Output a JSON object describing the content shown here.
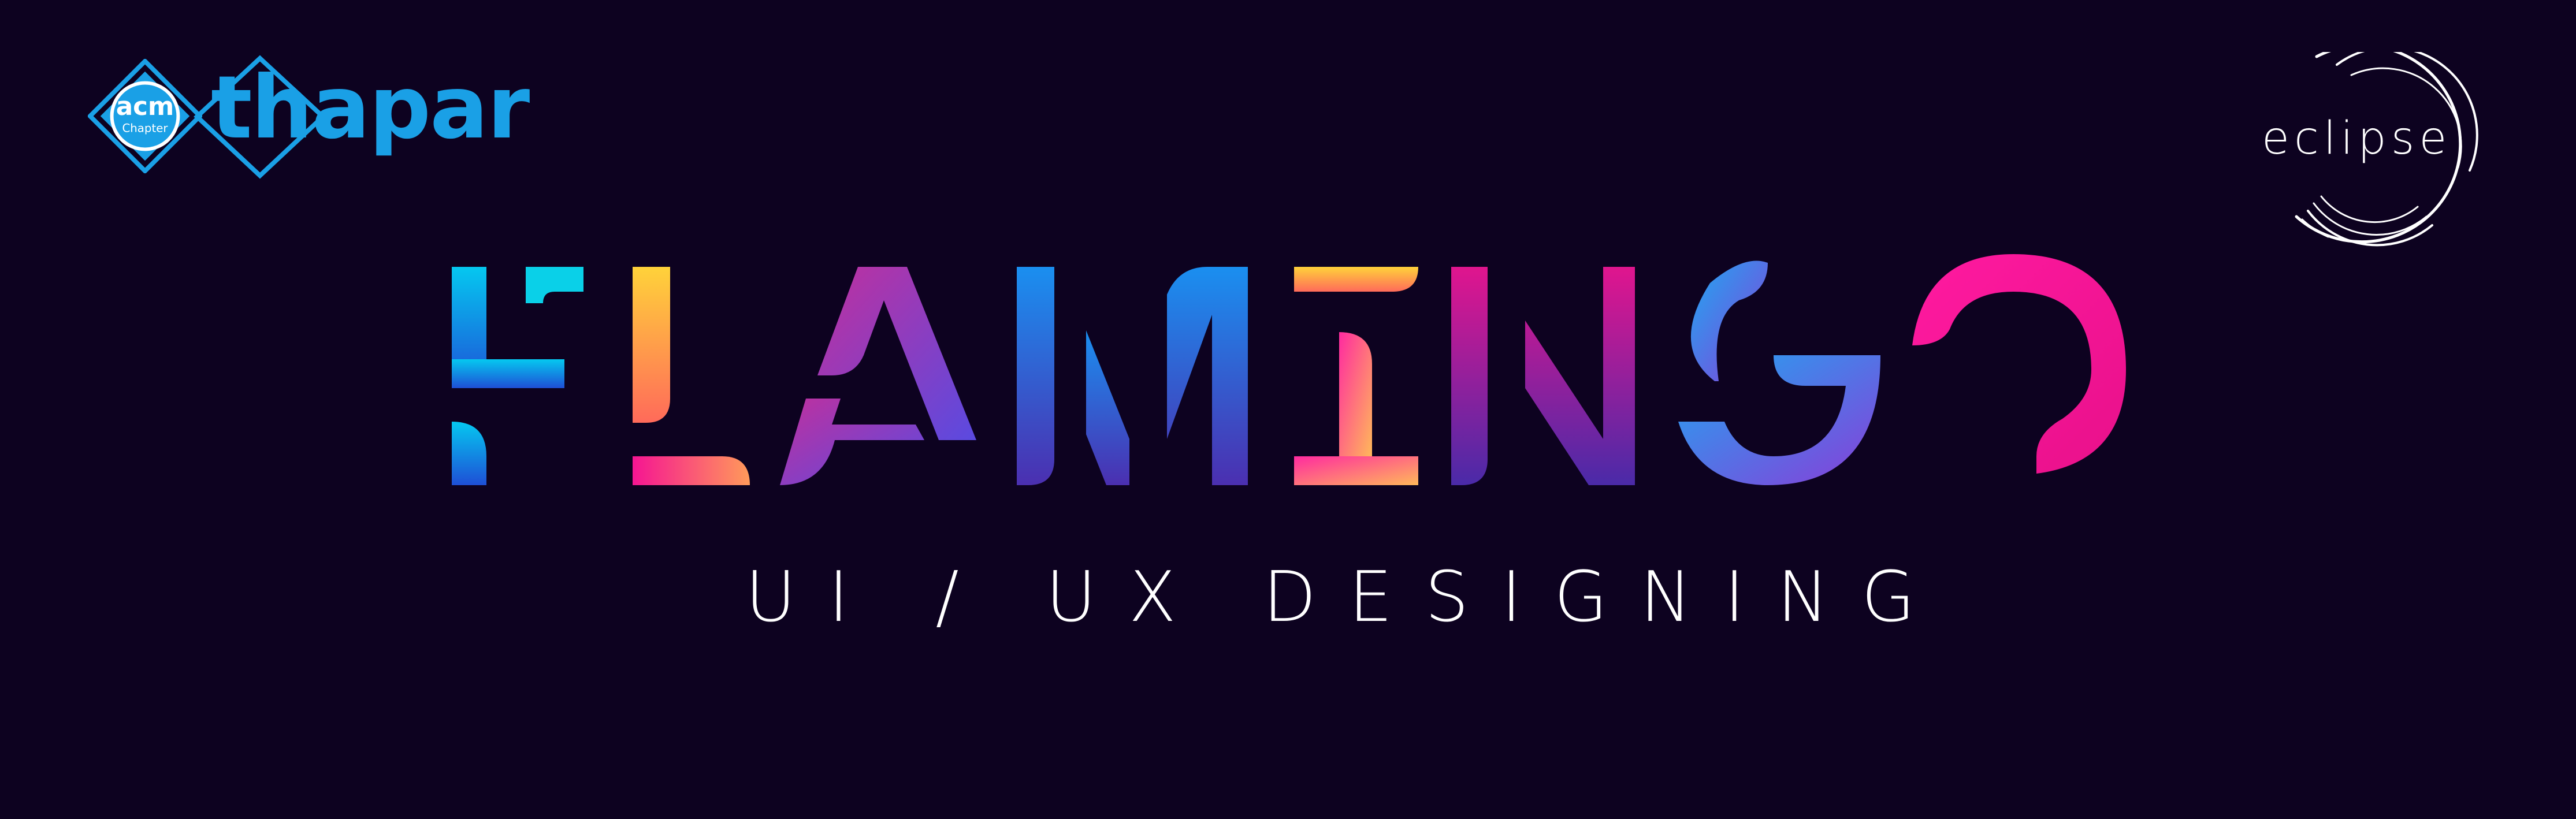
{
  "branding": {
    "left_logo_wordmark": "thapar",
    "left_logo_badge": [
      "acm",
      "Chapter"
    ],
    "right_logo_wordmark": "eclipse"
  },
  "headline": {
    "title": "FLAMINGO",
    "subtitle": "UI / UX DESIGNING"
  },
  "colors": {
    "background": "#0d0220",
    "acm_blue": "#1aa0e6",
    "gradient_cyan": "#05c8f0",
    "gradient_blue": "#1e6fe8",
    "gradient_purple": "#7a3fd6",
    "gradient_pink": "#f50a9a",
    "gradient_yellow": "#ffd23a",
    "text_white": "#ffffff"
  },
  "icons": [
    "acm-diamond-icon",
    "eclipse-rings-icon"
  ]
}
